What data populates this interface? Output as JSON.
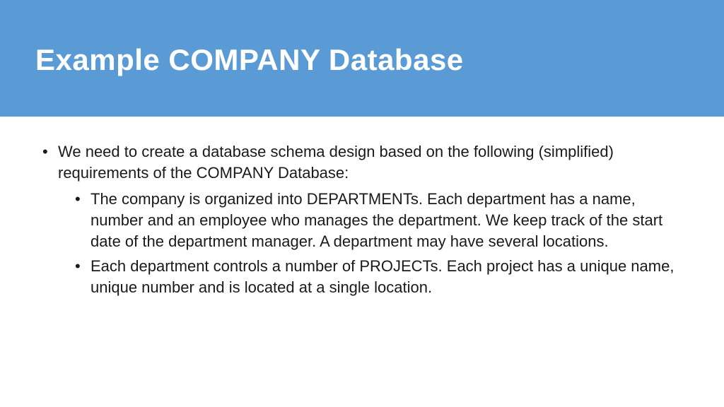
{
  "header": {
    "title": "Example COMPANY Database"
  },
  "content": {
    "intro": "We need to create a database schema design based on the following (simplified) requirements of the COMPANY Database:",
    "bullets": [
      "The company is organized into DEPARTMENTs. Each department has a name, number and an employee who manages the department. We keep track of the start date of the department manager. A department may have several locations.",
      "Each department controls a number of PROJECTs. Each project has a unique name, unique number and is located at a single location."
    ]
  }
}
